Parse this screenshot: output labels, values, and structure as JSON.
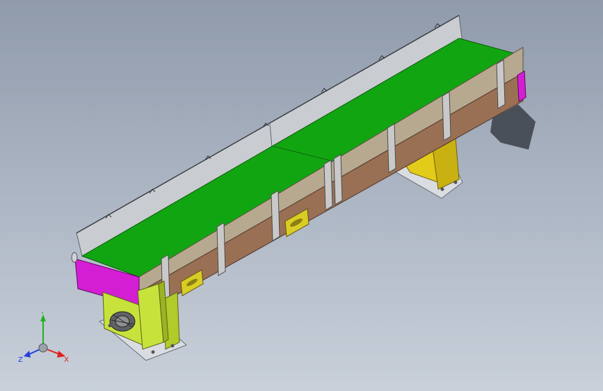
{
  "viewport": {
    "background_top": "#8f9aab",
    "background_bottom": "#c9d0da"
  },
  "model": {
    "belt_color": "#12a512",
    "side_frame_upper_color": "#b7a98f",
    "side_frame_lower_color": "#9a7055",
    "end_cap_color": "#d31ed3",
    "stand_color": "#c8e23c",
    "rear_stand_color": "#e3cb1a",
    "guard_rail_color": "#c9ccd0",
    "bracket_color": "#b9b9b9"
  },
  "triad": {
    "x_label": "X",
    "y_label": "Y",
    "z_label": "Z",
    "x_color": "#e02020",
    "y_color": "#20b020",
    "z_color": "#2040e0"
  }
}
